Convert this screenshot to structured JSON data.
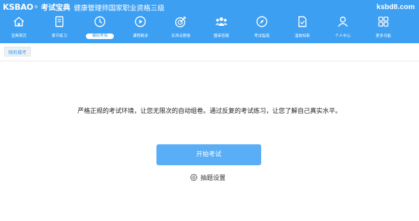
{
  "brand": {
    "logo": "KSBAO",
    "reg": "®",
    "sub": "考试宝典",
    "title": "健康管理师国家职业资格三级"
  },
  "site": "ksbd8.com",
  "nav": [
    {
      "label": "宝典首页",
      "icon": "home-icon"
    },
    {
      "label": "章节练习",
      "icon": "book-icon"
    },
    {
      "label": "模拟考场",
      "icon": "clock-icon",
      "active": true
    },
    {
      "label": "课程精讲",
      "icon": "video-icon"
    },
    {
      "label": "名师点题卷",
      "icon": "target-icon"
    },
    {
      "label": "圈审答疑",
      "icon": "group-icon"
    },
    {
      "label": "考试指南",
      "icon": "compass-icon"
    },
    {
      "label": "温故知新",
      "icon": "note-icon"
    },
    {
      "label": "个人中心",
      "icon": "user-icon"
    },
    {
      "label": "更多功能",
      "icon": "grid-icon"
    }
  ],
  "breadcrumb": "随机模考",
  "description": "严格正规的考试环境，让您无限次的自动组卷。通过反复的考试练习，让您了解自己真实水平。",
  "start_button": "开始考试",
  "settings_label": "抽题设置",
  "colors": {
    "primary": "#3d9ff2",
    "button": "#5aaef5"
  }
}
